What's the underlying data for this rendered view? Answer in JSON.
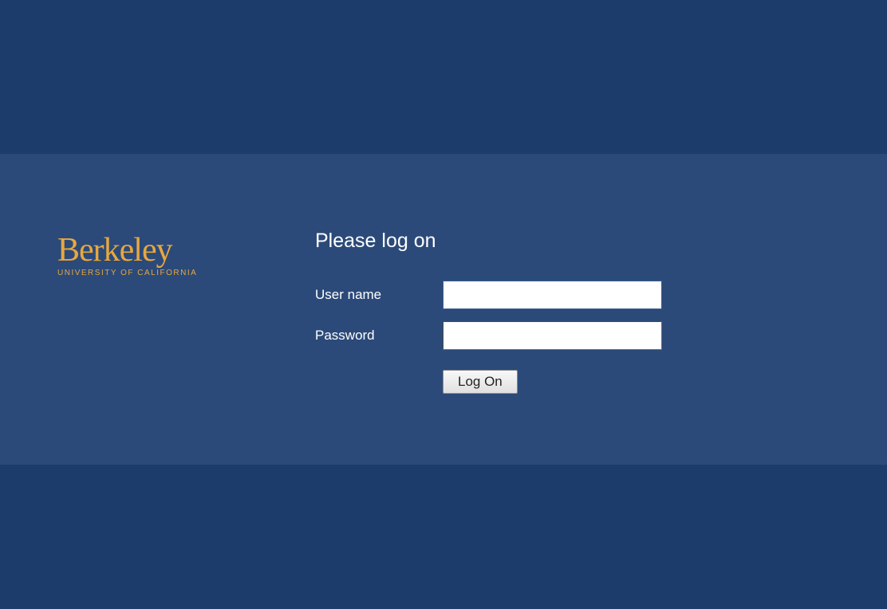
{
  "logo": {
    "main": "Berkeley",
    "subtitle": "UNIVERSITY OF CALIFORNIA"
  },
  "form": {
    "heading": "Please log on",
    "username_label": "User name",
    "password_label": "Password",
    "username_value": "",
    "password_value": "",
    "logon_button": "Log On"
  },
  "colors": {
    "background": "#1c3c6c",
    "panel": "#2b4a79",
    "accent": "#e8a73f",
    "text": "#ffffff"
  }
}
